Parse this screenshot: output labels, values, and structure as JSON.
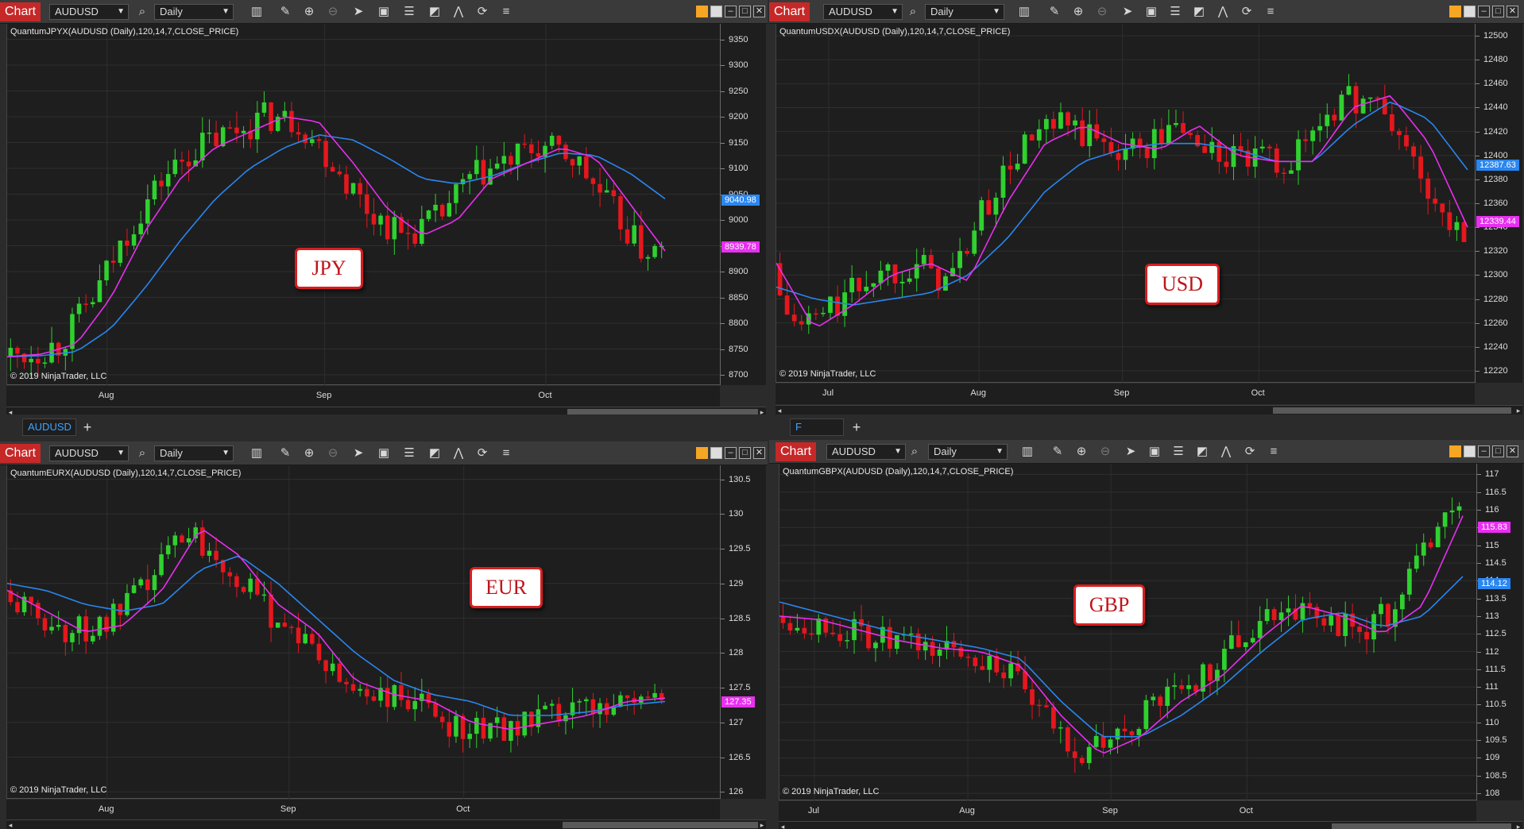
{
  "toolbar": {
    "timeframe": "Daily",
    "copyright": "© 2019 NinjaTrader, LLC",
    "colors": {
      "up": "#2fd12f",
      "down": "#e5171d",
      "fast_ma": "#e82ff0",
      "slow_ma": "#2a86f0",
      "background": "#1e1e1e"
    },
    "icons": [
      "bar-chart-icon",
      "pencil-icon",
      "zoom-in-icon",
      "zoom-out-icon",
      "cursor-icon",
      "properties-icon",
      "data-box-icon",
      "strategy-icon",
      "indicator-icon",
      "reload-icon",
      "menu-icon"
    ]
  },
  "panels": [
    {
      "id": "jpy",
      "tab_label": "Chart",
      "instrument": "AUDUSD",
      "timeframe": "Daily",
      "indicator_label": "QuantumJPYX(AUDUSD (Daily),120,14,7,CLOSE_PRICE)",
      "badge": "JPY",
      "y_ticks": [
        "9350",
        "9300",
        "9250",
        "9200",
        "9150",
        "9100",
        "9050",
        "9000",
        "8950",
        "8900",
        "8850",
        "8800",
        "8750",
        "8700"
      ],
      "x_ticks": [
        "Aug",
        "Sep",
        "Oct"
      ],
      "tags": {
        "slow": "9040.98",
        "fast": "8939.78"
      },
      "bottom_tab": "AUDUSD"
    },
    {
      "id": "usd",
      "tab_label": "Chart",
      "instrument": "AUDUSD",
      "timeframe": "Daily",
      "indicator_label": "QuantumUSDX(AUDUSD (Daily),120,14,7,CLOSE_PRICE)",
      "badge": "USD",
      "y_ticks": [
        "12500",
        "12480",
        "12460",
        "12440",
        "12420",
        "12400",
        "12380",
        "12360",
        "12340",
        "12320",
        "12300",
        "12280",
        "12260",
        "12240",
        "12220"
      ],
      "x_ticks": [
        "Jul",
        "Aug",
        "Sep",
        "Oct"
      ],
      "tags": {
        "slow": "12387.63",
        "fast": "12339.44"
      },
      "bottom_tab": "F"
    },
    {
      "id": "eur",
      "tab_label": "Chart",
      "instrument": "AUDUSD",
      "timeframe": "Daily",
      "indicator_label": "QuantumEURX(AUDUSD (Daily),120,14,7,CLOSE_PRICE)",
      "badge": "EUR",
      "y_ticks": [
        "130.5",
        "130",
        "129.5",
        "129",
        "128.5",
        "128",
        "127.5",
        "127",
        "126.5",
        "126"
      ],
      "x_ticks": [
        "Aug",
        "Sep",
        "Oct"
      ],
      "tags": {
        "fast": "127.35"
      }
    },
    {
      "id": "gbp",
      "tab_label": "Chart",
      "instrument": "AUDUSD",
      "timeframe": "Daily",
      "indicator_label": "QuantumGBPX(AUDUSD (Daily),120,14,7,CLOSE_PRICE)",
      "badge": "GBP",
      "y_ticks": [
        "117",
        "116.5",
        "116",
        "115.5",
        "115",
        "114.5",
        "114",
        "113.5",
        "113",
        "112.5",
        "112",
        "111.5",
        "111",
        "110.5",
        "110",
        "109.5",
        "109",
        "108.5",
        "108"
      ],
      "x_ticks": [
        "Jul",
        "Aug",
        "Sep",
        "Oct"
      ],
      "tags": {
        "fast": "115.83",
        "slow": "114.12"
      }
    }
  ],
  "chart_data": [
    {
      "type": "line",
      "title": "QuantumJPYX(AUDUSD (Daily),120,14,7,CLOSE_PRICE)",
      "x": [
        "Aug",
        "Sep",
        "Oct"
      ],
      "series": [
        {
          "values": [
            8735,
            8740,
            8760,
            8850,
            8980,
            9080,
            9140,
            9170,
            9200,
            9190,
            9110,
            9020,
            8970,
            9000,
            9080,
            9110,
            9140,
            9120,
            9030,
            8940
          ]
        },
        {
          "values": [
            8735,
            8737,
            8745,
            8790,
            8870,
            8960,
            9040,
            9100,
            9140,
            9165,
            9155,
            9120,
            9080,
            9070,
            9085,
            9110,
            9130,
            9125,
            9090,
            9041
          ]
        }
      ],
      "ylim": [
        8680,
        9380
      ]
    },
    {
      "type": "line",
      "title": "QuantumUSDX(AUDUSD (Daily),120,14,7,CLOSE_PRICE)",
      "x": [
        "Jul",
        "Aug",
        "Sep",
        "Oct"
      ],
      "series": [
        {
          "values": [
            12310,
            12255,
            12275,
            12300,
            12310,
            12295,
            12360,
            12410,
            12425,
            12410,
            12405,
            12425,
            12400,
            12395,
            12395,
            12440,
            12450,
            12410,
            12340
          ]
        },
        {
          "values": [
            12290,
            12280,
            12275,
            12280,
            12285,
            12300,
            12330,
            12370,
            12395,
            12405,
            12410,
            12410,
            12405,
            12395,
            12395,
            12425,
            12445,
            12430,
            12388
          ]
        }
      ],
      "ylim": [
        12210,
        12510
      ]
    },
    {
      "type": "line",
      "title": "QuantumEURX(AUDUSD (Daily),120,14,7,CLOSE_PRICE)",
      "x": [
        "Aug",
        "Sep",
        "Oct"
      ],
      "series": [
        {
          "values": [
            128.9,
            128.6,
            128.3,
            128.4,
            128.9,
            129.8,
            129.4,
            128.7,
            128.3,
            127.6,
            127.4,
            127.3,
            127.0,
            126.9,
            127.0,
            127.1,
            127.3,
            127.35
          ]
        },
        {
          "values": [
            129.0,
            128.9,
            128.7,
            128.6,
            128.7,
            129.2,
            129.4,
            129.0,
            128.5,
            128.0,
            127.6,
            127.4,
            127.3,
            127.1,
            127.1,
            127.15,
            127.25,
            127.3
          ]
        }
      ],
      "ylim": [
        125.9,
        130.7
      ]
    },
    {
      "type": "line",
      "title": "QuantumGBPX(AUDUSD (Daily),120,14,7,CLOSE_PRICE)",
      "x": [
        "Jul",
        "Aug",
        "Sep",
        "Oct"
      ],
      "series": [
        {
          "values": [
            113.0,
            112.9,
            112.6,
            112.3,
            112.1,
            112.0,
            111.6,
            110.2,
            109.1,
            109.6,
            110.6,
            111.3,
            112.4,
            113.3,
            113.0,
            112.5,
            113.3,
            115.83
          ]
        },
        {
          "values": [
            113.4,
            113.1,
            112.8,
            112.5,
            112.3,
            112.1,
            111.8,
            110.6,
            109.6,
            109.6,
            110.2,
            111.0,
            112.0,
            112.9,
            113.1,
            112.7,
            113.0,
            114.12
          ]
        }
      ],
      "ylim": [
        107.8,
        117.3
      ]
    }
  ]
}
